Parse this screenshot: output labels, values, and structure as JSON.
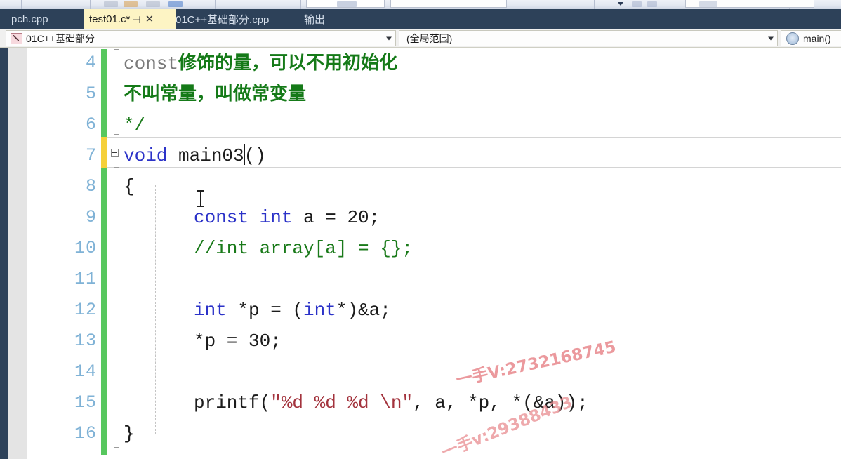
{
  "toolbar": {
    "note": "partially visible toolbar row at very top"
  },
  "tabs": [
    {
      "label": "pch.cpp",
      "active": false,
      "modified": false
    },
    {
      "label": "test01.c*",
      "active": true,
      "modified": true,
      "pin_icon": "pin-icon",
      "close_icon": "close-icon"
    },
    {
      "label": "01C++基础部分.cpp",
      "active": false,
      "modified": false
    },
    {
      "label": "输出",
      "active": false,
      "modified": false
    }
  ],
  "navbar": {
    "project_icon": "project-icon",
    "project": "01C++基础部分",
    "scope": "(全局范围)",
    "member_icon": "member-icon",
    "member": "main()",
    "dropdown_icon": "chevron-down-icon"
  },
  "editor": {
    "first_line": 4,
    "line_numbers": [
      4,
      5,
      6,
      7,
      8,
      9,
      10,
      11,
      12,
      13,
      14,
      15,
      16
    ],
    "current_line": 7,
    "outline_icon": "collapse-minus-icon",
    "lines": [
      {
        "n": 4,
        "text": "const修饰的量，可以不用初始化"
      },
      {
        "n": 5,
        "text": "不叫常量，叫做常变量"
      },
      {
        "n": 6,
        "text": "*/"
      },
      {
        "n": 7,
        "text": "void main03()"
      },
      {
        "n": 8,
        "text": "{"
      },
      {
        "n": 9,
        "text": "    const int a = 20;"
      },
      {
        "n": 10,
        "text": "    //int array[a] = {};"
      },
      {
        "n": 11,
        "text": ""
      },
      {
        "n": 12,
        "text": "    int *p = (int*)&a;"
      },
      {
        "n": 13,
        "text": "    *p = 30;"
      },
      {
        "n": 14,
        "text": ""
      },
      {
        "n": 15,
        "text": "    printf(\"%d %d %d \\n\", a, *p, *(&a));"
      },
      {
        "n": 16,
        "text": "}"
      }
    ],
    "tokens": {
      "l4_const": "const",
      "l4_cjk": "修饰的量，可以不用初始化",
      "l5_cjk": "不叫常量，叫做常变量",
      "l6": "*/",
      "l7_void": "void",
      "l7_name": " main03",
      "l7_parens": "()",
      "l8": "{",
      "l9_const": "const",
      "l9_int": " int",
      "l9_rest": " a = 20;",
      "l10": "//int array[a] = {};",
      "l12_int": "int",
      "l12_mid": " *p = (",
      "l12_int2": "int",
      "l12_rest": "*)&a;",
      "l13": "*p = 30;",
      "l15_a": "printf(",
      "l15_str": "\"%d %d %d \\n\"",
      "l15_b": ", a, *p, *(&a));",
      "l16": "}"
    },
    "colors": {
      "keyword": "#2b32c8",
      "comment": "#1a7a1a",
      "string": "#a3333d",
      "plain": "#1c1c1c",
      "line_number": "#7fb2d6",
      "change_bar_saved": "#57c75e",
      "change_bar_unsaved": "#f5d03a",
      "tab_active_bg": "#fdf4c4",
      "tab_bar_bg": "#2d4159"
    }
  },
  "watermarks": [
    {
      "text": "一手V:2732168745"
    },
    {
      "text": "一手v:29388433"
    }
  ]
}
